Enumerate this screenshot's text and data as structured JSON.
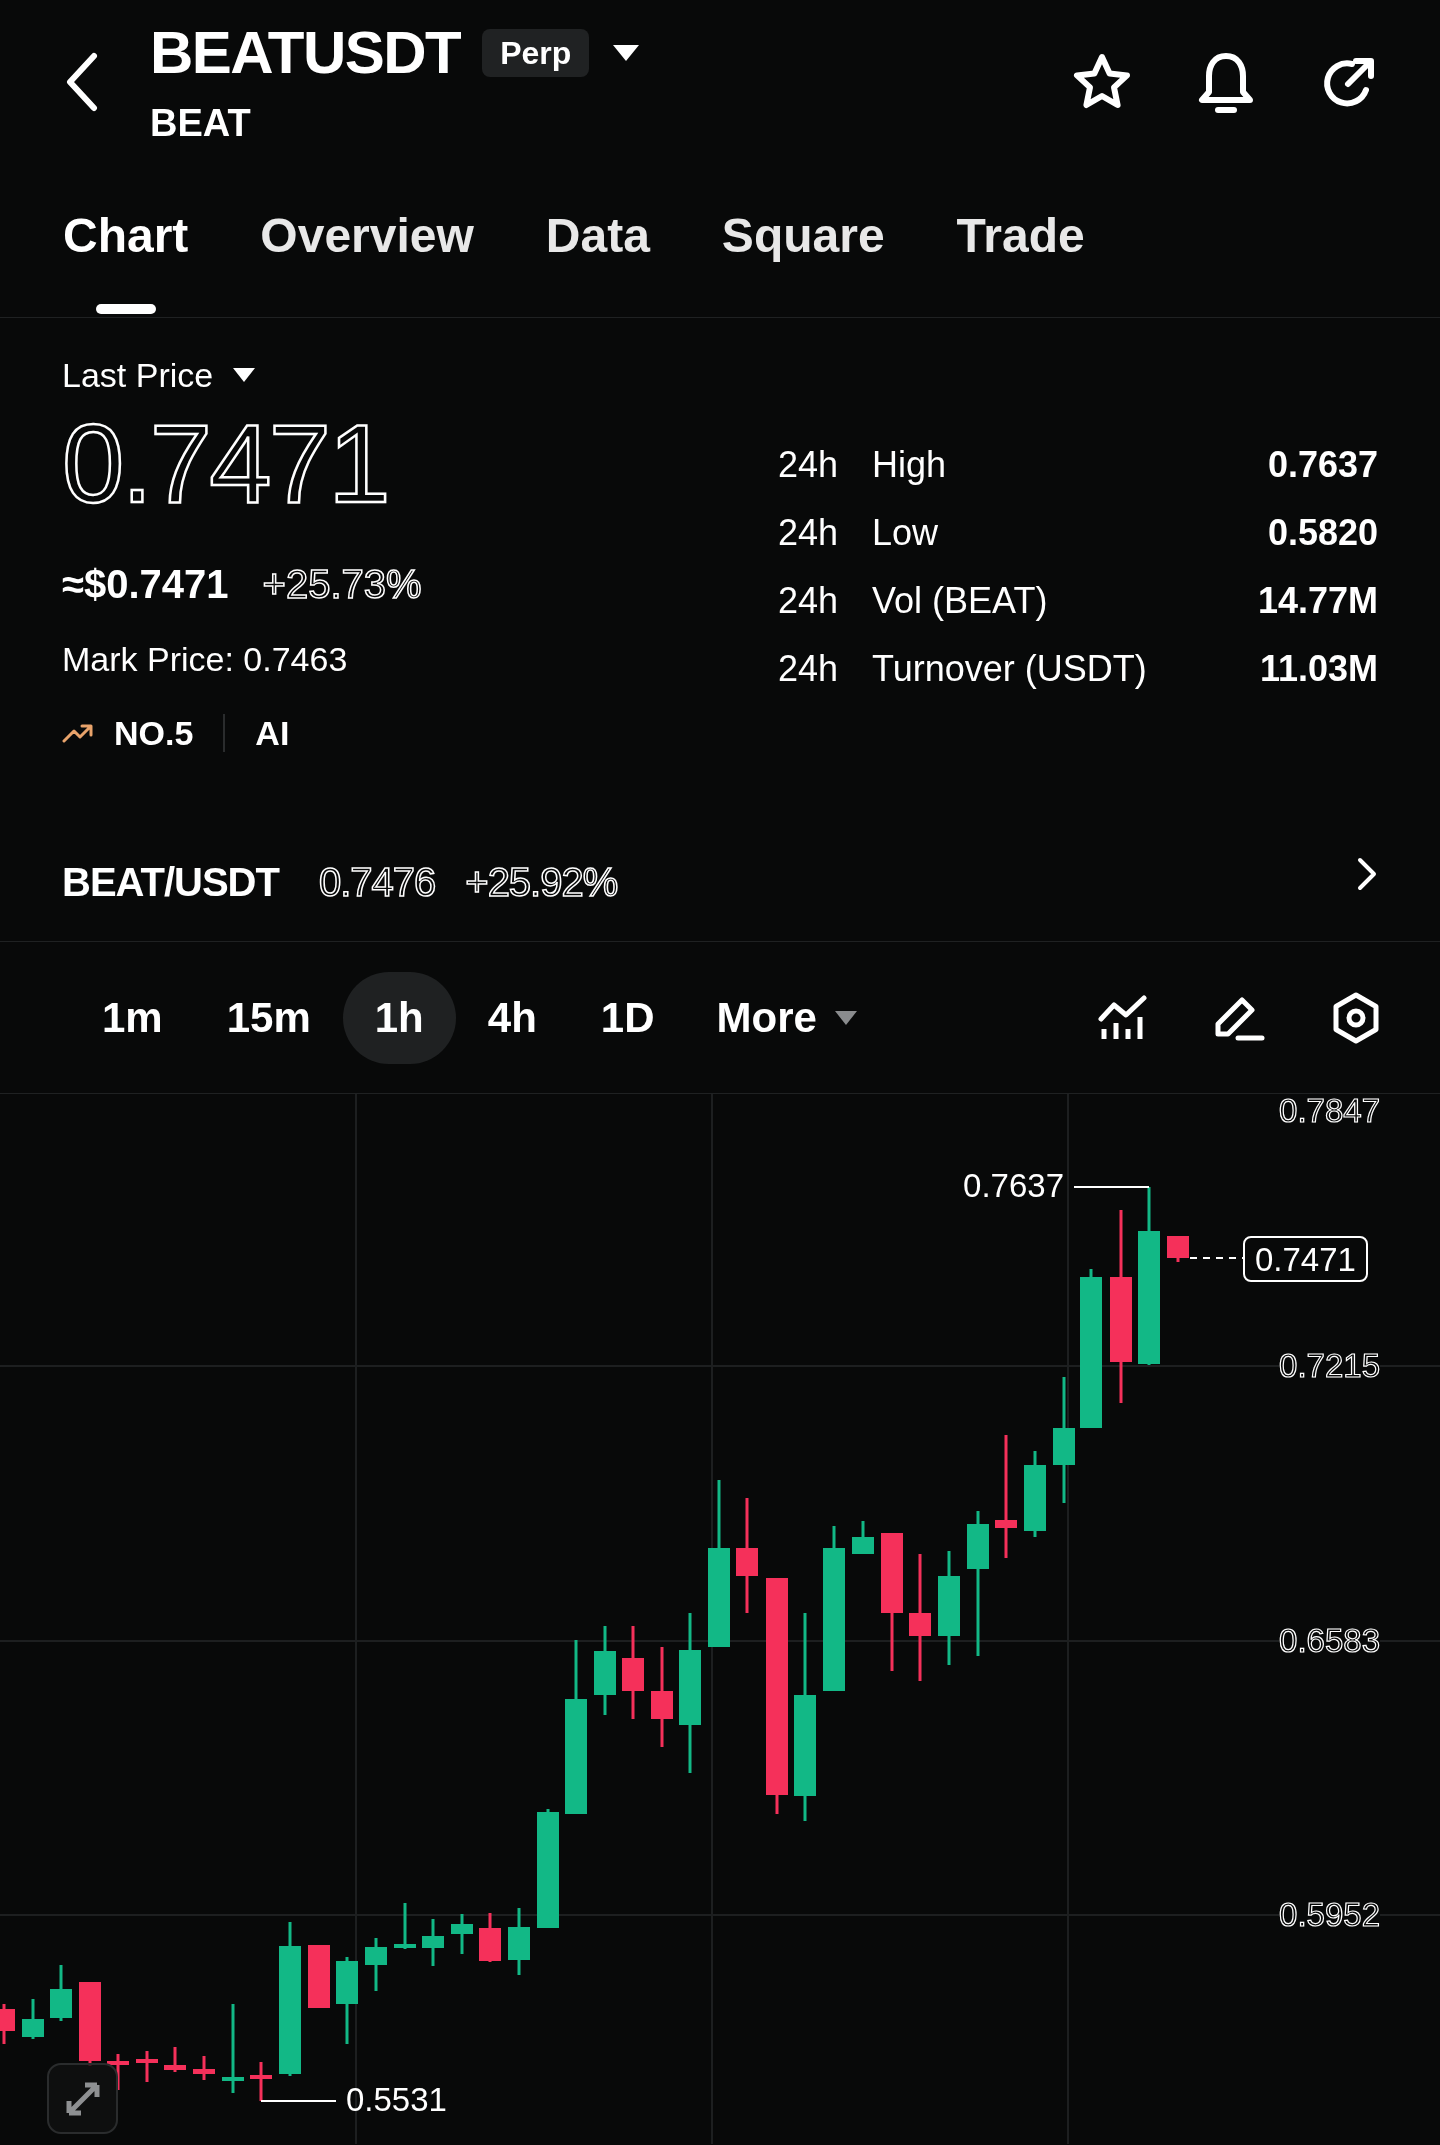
{
  "header": {
    "symbol": "BEATUSDT",
    "badge": "Perp",
    "base": "BEAT"
  },
  "tabs": [
    {
      "label": "Chart",
      "selected": true
    },
    {
      "label": "Overview",
      "selected": false
    },
    {
      "label": "Data",
      "selected": false
    },
    {
      "label": "Square",
      "selected": false
    },
    {
      "label": "Trade",
      "selected": false
    }
  ],
  "price": {
    "label": "Last Price",
    "value": "0.7471",
    "usd": "≈$0.7471",
    "change": "+25.73%",
    "mark": "Mark Price: 0.7463",
    "rank": "NO.5",
    "tag": "AI"
  },
  "stats": [
    {
      "period": "24h",
      "label": "High",
      "value": "0.7637"
    },
    {
      "period": "24h",
      "label": "Low",
      "value": "0.5820"
    },
    {
      "period": "24h",
      "label": "Vol (BEAT)",
      "value": "14.77M"
    },
    {
      "period": "24h",
      "label": "Turnover (USDT)",
      "value": "11.03M"
    }
  ],
  "spot": {
    "pair": "BEAT/USDT",
    "price": "0.7476",
    "change": "+25.92%"
  },
  "timeframes": [
    {
      "label": "1m",
      "selected": false
    },
    {
      "label": "15m",
      "selected": false
    },
    {
      "label": "1h",
      "selected": true
    },
    {
      "label": "4h",
      "selected": false
    },
    {
      "label": "1D",
      "selected": false
    }
  ],
  "more": "More",
  "chart": {
    "axis_labels": [
      "0.7847",
      "0.7215",
      "0.6583",
      "0.5952"
    ],
    "high_label": "0.7637",
    "low_label": "0.5531",
    "last_price": "0.7471"
  }
}
